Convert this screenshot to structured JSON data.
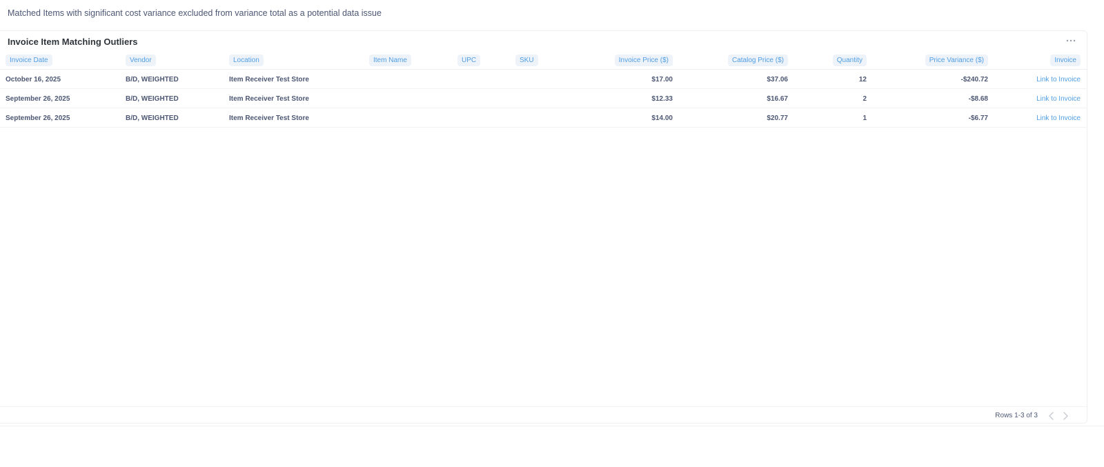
{
  "note": "Matched Items with significant cost variance excluded from variance total as a potential data issue",
  "card": {
    "title": "Invoice Item Matching Outliers",
    "more_icon": "ellipsis-icon"
  },
  "table": {
    "columns": [
      "Invoice Date",
      "Vendor",
      "Location",
      "Item Name",
      "UPC",
      "SKU",
      "Invoice Price ($)",
      "Catalog Price ($)",
      "Quantity",
      "Price Variance ($)",
      "Invoice"
    ],
    "rows": [
      {
        "date": "October 16, 2025",
        "vendor": "B/D, WEIGHTED",
        "location": "Item Receiver Test Store",
        "item_name": "",
        "upc": "",
        "sku": "",
        "invoice_price": "$17.00",
        "catalog_price": "$37.06",
        "quantity": "12",
        "variance": "-$240.72",
        "link": "Link to Invoice"
      },
      {
        "date": "September 26, 2025",
        "vendor": "B/D, WEIGHTED",
        "location": "Item Receiver Test Store",
        "item_name": "",
        "upc": "",
        "sku": "",
        "invoice_price": "$12.33",
        "catalog_price": "$16.67",
        "quantity": "2",
        "variance": "-$8.68",
        "link": "Link to Invoice"
      },
      {
        "date": "September 26, 2025",
        "vendor": "B/D, WEIGHTED",
        "location": "Item Receiver Test Store",
        "item_name": "",
        "upc": "",
        "sku": "",
        "invoice_price": "$14.00",
        "catalog_price": "$20.77",
        "quantity": "1",
        "variance": "-$6.77",
        "link": "Link to Invoice"
      }
    ]
  },
  "footer": {
    "rows_label": "Rows 1-3 of 3",
    "prev_icon": "chevron-left-icon",
    "next_icon": "chevron-right-icon"
  },
  "colors": {
    "accent": "#509ee3",
    "text": "#4c5773",
    "pill_bg": "#eef3fa"
  }
}
